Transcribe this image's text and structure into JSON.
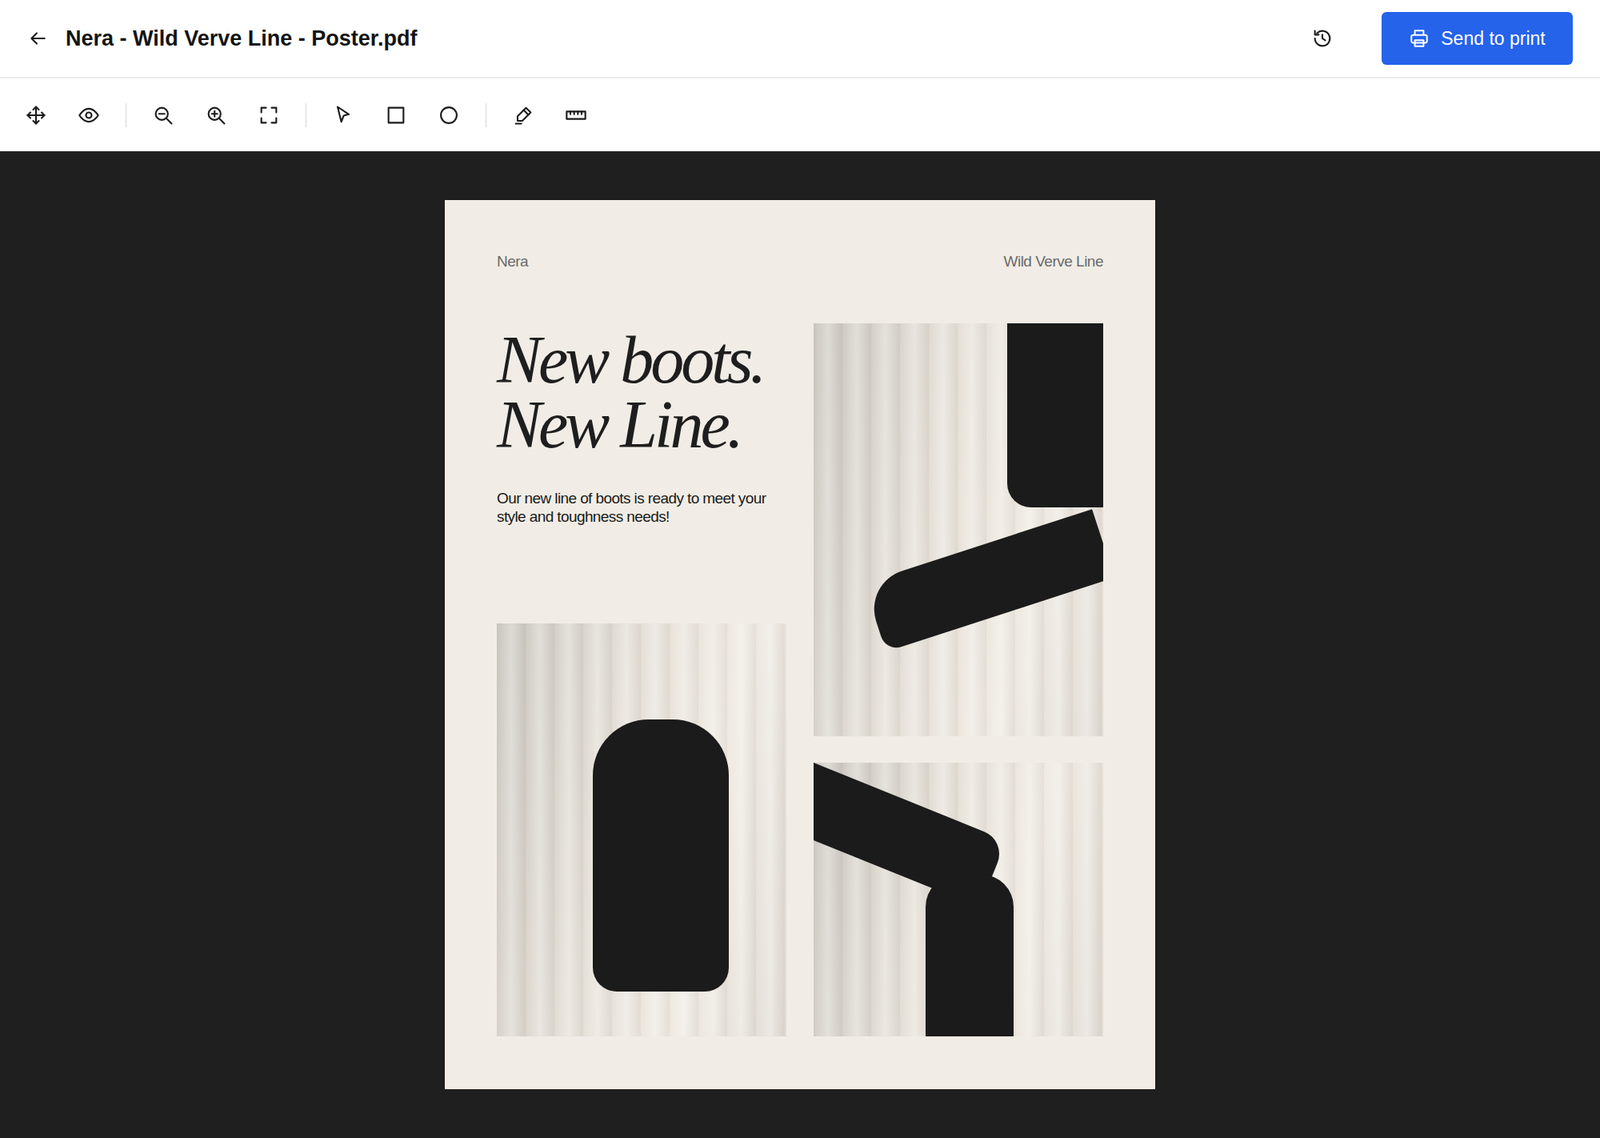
{
  "window": {
    "title": "Nera - Wild Verve Line - Poster.pdf"
  },
  "header": {
    "send_button": "Send to print"
  },
  "poster": {
    "brand": "Nera",
    "line_name": "Wild Verve Line",
    "headline": [
      "New boots.",
      "New Line."
    ],
    "body": "Our new line of boots is ready to meet your style and toughness needs!"
  }
}
